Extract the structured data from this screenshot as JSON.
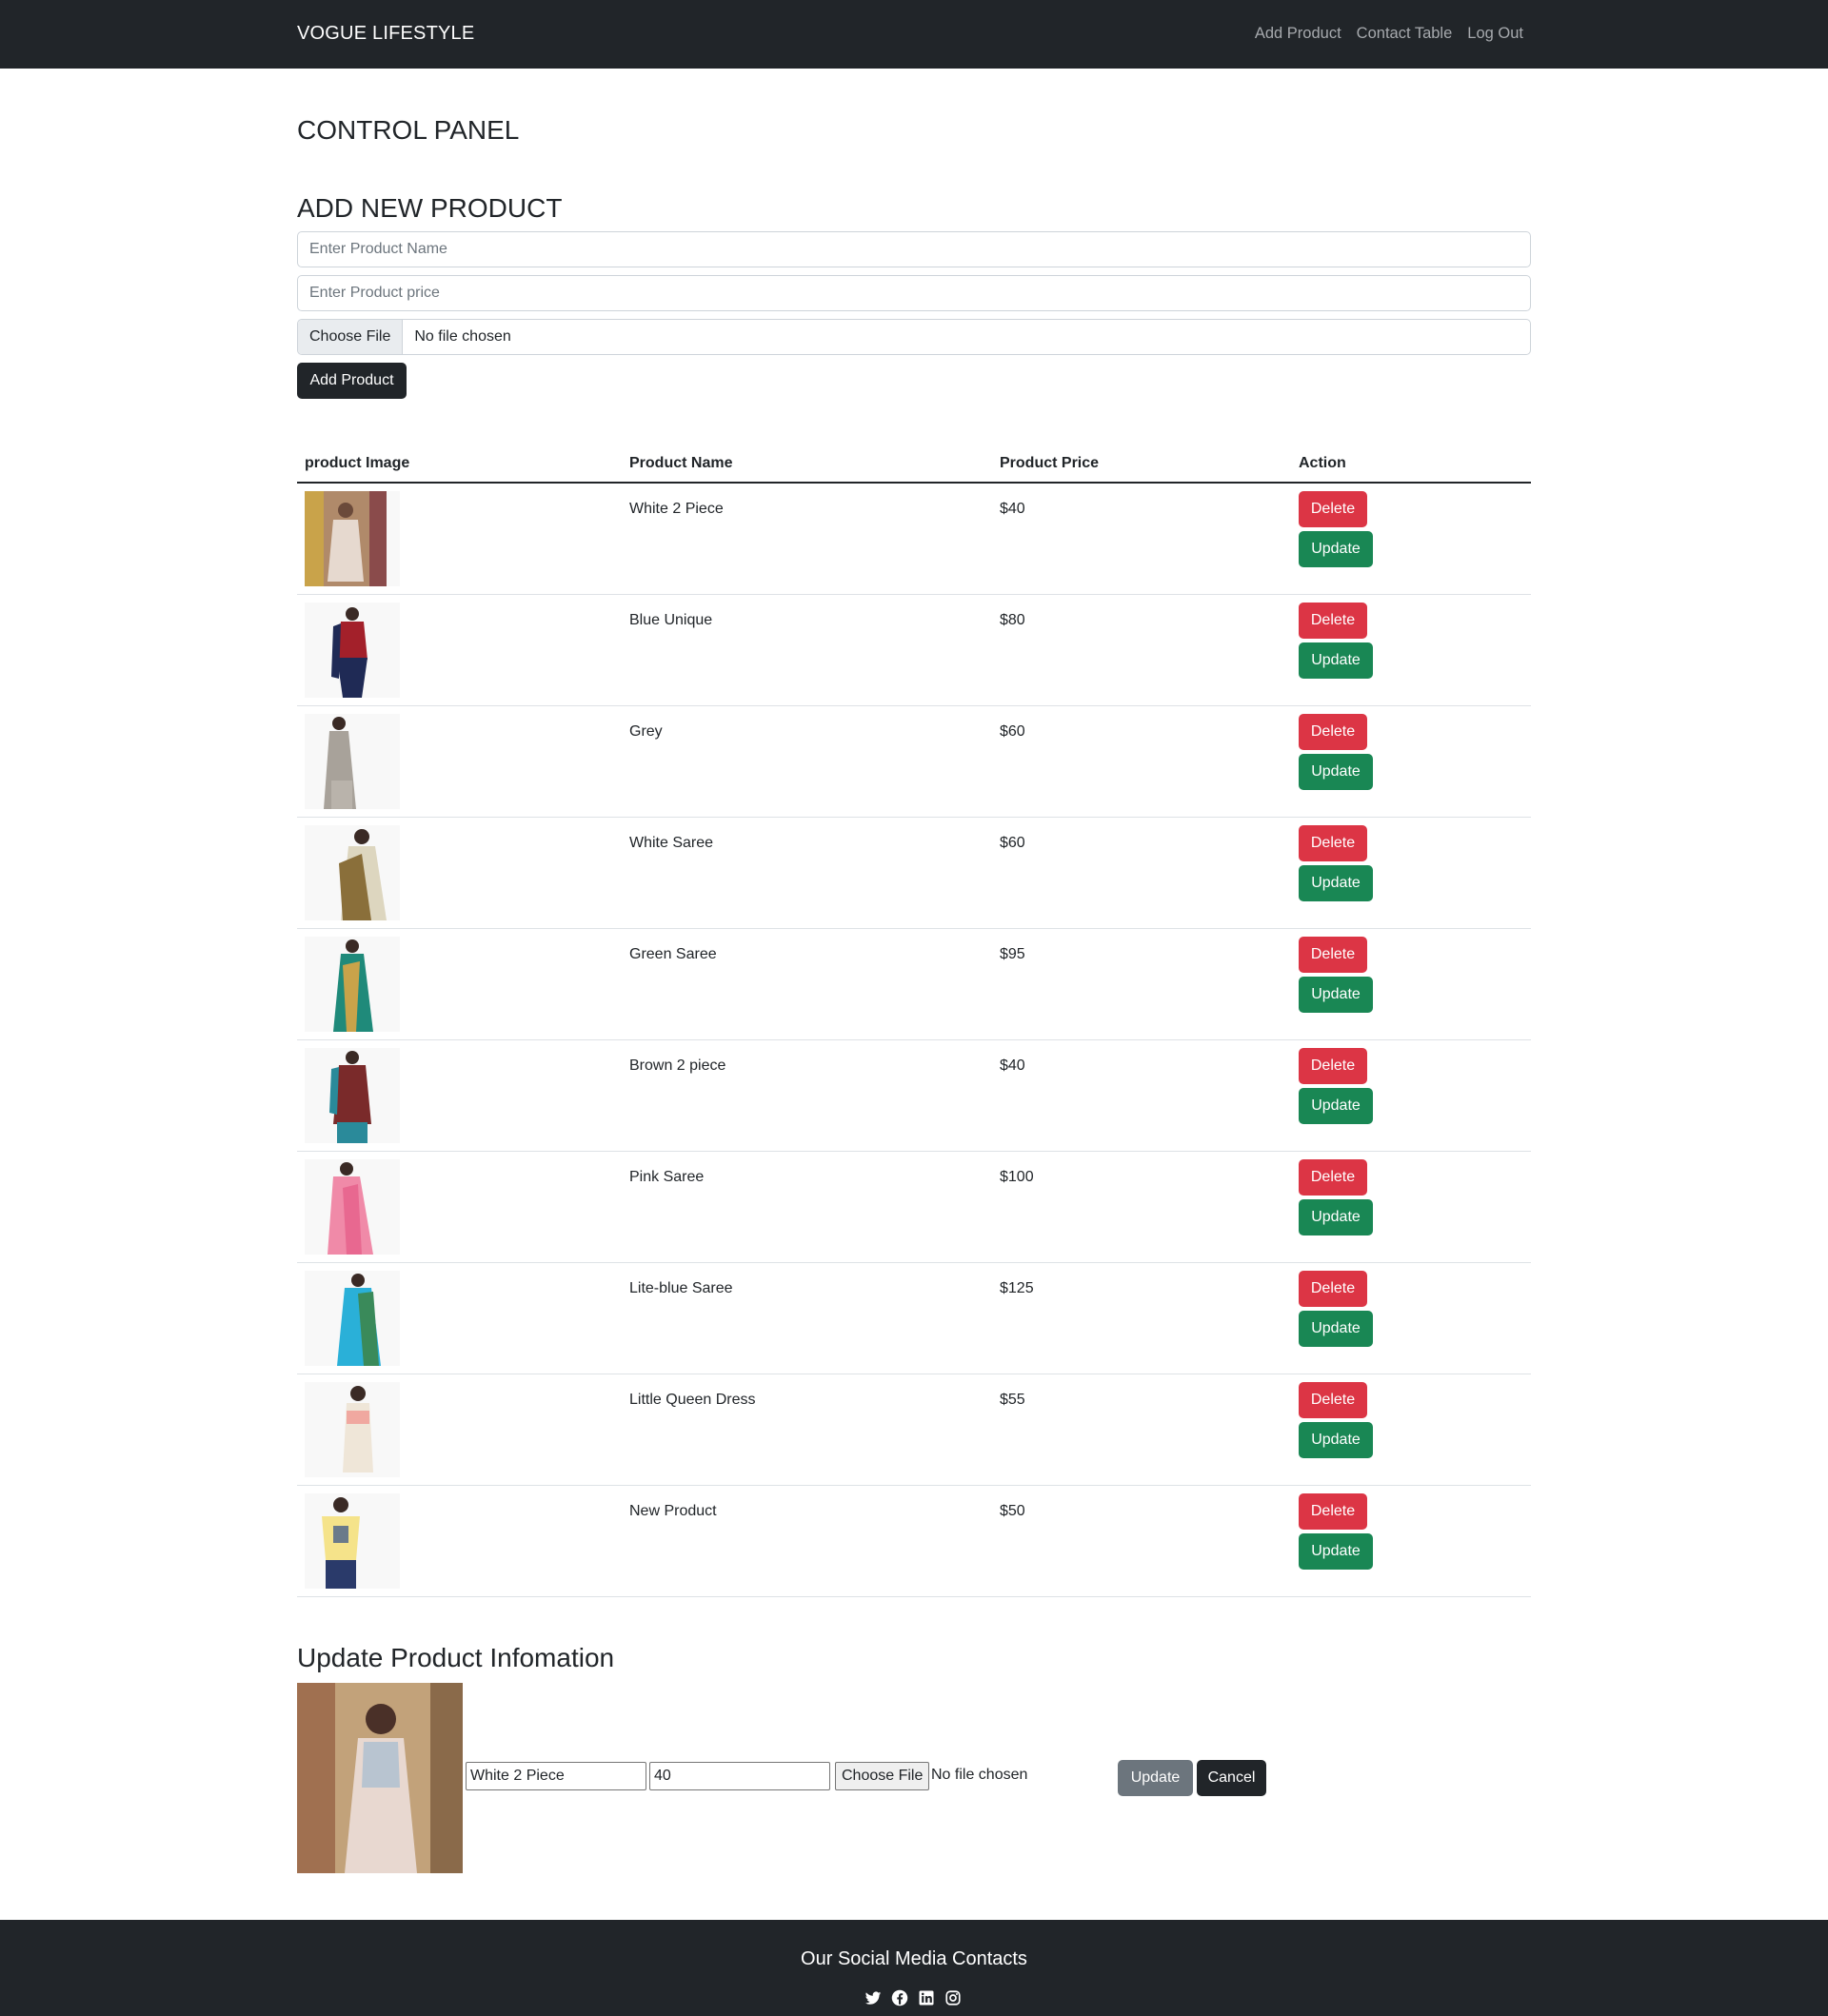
{
  "navbar": {
    "brand": "VOGUE LIFESTYLE",
    "links": [
      "Add Product",
      "Contact Table",
      "Log Out"
    ]
  },
  "headings": {
    "control_panel": "CONTROL PANEL",
    "add_new_product": "ADD NEW PRODUCT",
    "update_product": "Update Product Infomation"
  },
  "add_form": {
    "name_placeholder": "Enter Product Name",
    "price_placeholder": "Enter Product price",
    "file_button": "Choose File",
    "file_status": "No file chosen",
    "submit_label": "Add Product"
  },
  "table": {
    "headers": [
      "product Image",
      "Product Name",
      "Product Price",
      "Action"
    ],
    "delete_label": "Delete",
    "update_label": "Update",
    "rows": [
      {
        "name": "White 2 Piece",
        "price": "$40"
      },
      {
        "name": "Blue Unique",
        "price": "$80"
      },
      {
        "name": "Grey",
        "price": "$60"
      },
      {
        "name": "White Saree",
        "price": "$60"
      },
      {
        "name": "Green Saree",
        "price": "$95"
      },
      {
        "name": "Brown 2 piece",
        "price": "$40"
      },
      {
        "name": "Pink Saree",
        "price": "$100"
      },
      {
        "name": "Lite-blue Saree",
        "price": "$125"
      },
      {
        "name": "Little Queen Dress",
        "price": "$55"
      },
      {
        "name": "New Product",
        "price": "$50"
      }
    ]
  },
  "update_form": {
    "name_value": "White 2 Piece",
    "price_value": "40",
    "file_button": "Choose File",
    "file_status": "No file chosen",
    "update_label": "Update",
    "cancel_label": "Cancel"
  },
  "footer": {
    "title": "Our Social Media Contacts",
    "icons": [
      "twitter-icon",
      "facebook-icon",
      "linkedin-icon",
      "instagram-icon"
    ]
  },
  "colors": {
    "navbar": "#212529",
    "delete": "#dc3545",
    "update": "#198754",
    "secondary": "#6c757d"
  }
}
